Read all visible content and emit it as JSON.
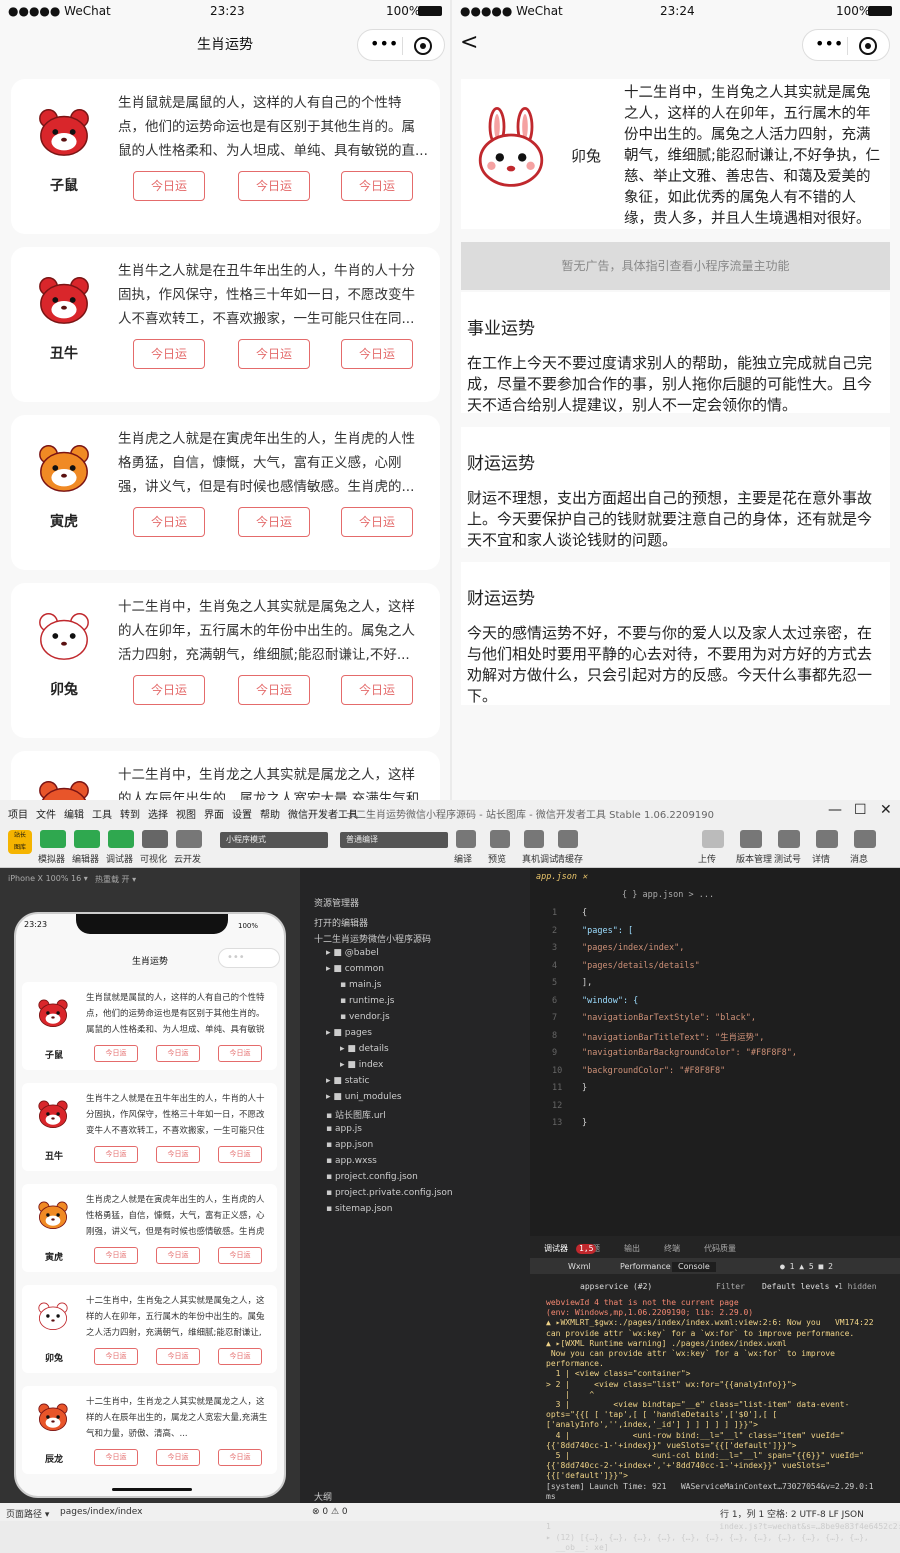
{
  "left_phone": {
    "status": {
      "carrier": "●●●●● WeChat",
      "time": "23:23",
      "battery": "100%"
    },
    "title": "生肖运势",
    "cards": [
      {
        "name": "子鼠",
        "desc": "生肖鼠就是属鼠的人，这样的人有自己的个性特点，他们的运势命运也是有区别于其他生肖的。属鼠的人性格柔和、为人坦成、单纯、具有敏锐的直...",
        "color": "#d9262b"
      },
      {
        "name": "丑牛",
        "desc": "生肖牛之人就是在丑牛年出生的人，牛肖的人十分固执，作风保守，性格三十年如一日，不愿改变牛人不喜欢转工，不喜欢搬家，一生可能只住在同...",
        "color": "#d9262b"
      },
      {
        "name": "寅虎",
        "desc": "生肖虎之人就是在寅虎年出生的人，生肖虎的人性格勇猛，自信，慷慨，大气，富有正义感，心刚强，讲义气，但是有时候也感情敏感。生肖虎的...",
        "color": "#f08a24"
      },
      {
        "name": "卯兔",
        "desc": "十二生肖中，生肖兔之人其实就是属兔之人，这样的人在卯年，五行属木的年份中出生的。属兔之人活力四射，充满朝气，维细腻;能忍耐谦让,不好...",
        "color": "#f6f0f0"
      },
      {
        "name": "辰龙",
        "desc": "十二生肖中，生肖龙之人其实就是属龙之人，这样的人在辰年出生的，属龙之人宽宏大量,充满生气和力量，骄傲、清高、...",
        "color": "#e8552a"
      }
    ],
    "button_label": "今日运"
  },
  "right_phone": {
    "status": {
      "carrier": "●●●●● WeChat",
      "time": "23:24",
      "battery": "100%"
    },
    "back": "<",
    "header": {
      "name": "卯兔",
      "desc": "十二生肖中，生肖兔之人其实就是属兔之人，这样的人在卯年，五行属木的年份中出生的。属兔之人活力四射，充满朝气，维细腻;能忍耐谦让,不好争执，仁慈、举止文雅、善忠告、和蔼及爱美的象征，如此优秀的属兔人有不错的人缘，贵人多，并且人生境遇相对很好。"
    },
    "ad": "暂无广告，具体指引查看小程序流量主功能",
    "sections": [
      {
        "title": "事业运势",
        "text": "在工作上今天不要过度请求别人的帮助，能独立完成就自己完成，尽量不要参加合作的事，别人拖你后腿的可能性大。且今天不适合给别人提建议，别人不一定会领你的情。"
      },
      {
        "title": "财运运势",
        "text": "财运不理想，支出方面超出自己的预想，主要是花在意外事故上。今天要保护自己的钱财就要注意自己的身体，还有就是今天不宜和家人谈论钱财的问题。"
      },
      {
        "title": "财运运势",
        "text": "今天的感情运势不好，不要与你的爱人以及家人太过亲密，在与他们相处时要用平静的心去对待，不要用为对方好的方式去劝解对方做什么，只会引起对方的反感。今天什么事都先忍一下。"
      }
    ]
  },
  "ide": {
    "menu": [
      "项目",
      "文件",
      "编辑",
      "工具",
      "转到",
      "选择",
      "视图",
      "界面",
      "设置",
      "帮助",
      "微信开发者工具"
    ],
    "window_title": "十二生肖运势微信小程序源码 - 站长图库 - 微信开发者工具 Stable 1.06.2209190",
    "toolbar_left": [
      "模拟器",
      "编辑器",
      "调试器",
      "可视化",
      "云开发"
    ],
    "mode": "小程序模式",
    "compile": "普通编译",
    "toolbar_mid": [
      "编译",
      "预览",
      "真机调试",
      "清缓存"
    ],
    "toolbar_right": [
      "上传",
      "版本管理",
      "测试号",
      "详情",
      "消息"
    ],
    "device": "iPhone X 100% 16 ▾",
    "hotreload": "热重载 开 ▾",
    "sim_time": "23:23",
    "sim_battery": "100%",
    "sim_title": "生肖运势",
    "explorer_title": "资源管理器",
    "open_editors": "打开的编辑器",
    "project": "十二生肖运势微信小程序源码",
    "files": [
      "@babel",
      "common",
      "main.js",
      "runtime.js",
      "vendor.js",
      "pages",
      "details",
      "index",
      "static",
      "uni_modules",
      "站长图库.url",
      "app.js",
      "app.json",
      "app.wxss",
      "project.config.json",
      "project.private.config.json",
      "sitemap.json"
    ],
    "outline": "大纲",
    "tab": "app.json",
    "crumb": "{ } app.json > ...",
    "code_lines": [
      "{",
      "  \"pages\": [",
      "    \"pages/index/index\",",
      "    \"pages/details/details\"",
      "  ],",
      "  \"window\": {",
      "    \"navigationBarTextStyle\": \"black\",",
      "    \"navigationBarTitleText\": \"生肖运势\",",
      "    \"navigationBarBackgroundColor\": \"#F8F8F8\",",
      "    \"backgroundColor\": \"#F8F8F8\"",
      "  }",
      "",
      "}"
    ],
    "console_tabs": [
      "调试器",
      "问题",
      "输出",
      "终端",
      "代码质量"
    ],
    "console_badge": "1,5",
    "devtools_tabs": [
      "Wxml",
      "Performance",
      "Console"
    ],
    "devtools_counts": "● 1 ▲ 5 ■ 2",
    "context": "appservice (#2)",
    "filter": "Filter",
    "levels": "Default levels ▾",
    "hidden": "1 hidden",
    "console_lines": [
      "webviewId 4 that is not the current page",
      "(env: Windows,mp,1.06.2209190; lib: 2.29.0)",
      "▲ ▸WXMLRT_$gwx:./pages/index/index.wxml:view:2:6: Now you   VM174:22",
      "can provide attr `wx:key` for a `wx:for` to improve performance.",
      "▲ ▸[WXML Runtime warning] ./pages/index/index.wxml",
      " Now you can provide attr `wx:key` for a `wx:for` to improve",
      "performance.",
      "  1 | <view class=\"container\">",
      "> 2 |     <view class=\"list\" wx:for=\"{{analyInfo}}\">",
      "    |    ^",
      "  3 |         <view bindtap=\"__e\" class=\"list-item\" data-event-",
      "opts=\"{{[ [ 'tap',[ [ 'handleDetails',['$0'],[ [",
      "['analyInfo','',index,'_id'] ] ] ] ] ] ]}}\">",
      "  4 |             <uni-row bind:__l=\"__l\" class=\"item\" vueId=\"",
      "{{'8dd740cc-1-'+index}}\" vueSlots=\"{{['default']}}\">",
      "  5 |                 <uni-col bind:__l=\"__l\" span=\"{{6}}\" vueId=\"",
      "{{'8dd740cc-2-'+index+','+'8dd740cc-1-'+index}}\" vueSlots=\"",
      "{{['default']}}\">",
      "[system] Launch Time: 921   WAServiceMainContext…73027054&v=2.29.0:1",
      "ms",
      "                                    index.js?t=wechat&s=…8be9e83f4e6452c2:41",
      "▸ (12) [{…}, {…}, {…}, {…}, {…}, {…}, {…}, {…}, {…}, {…}, {…}, {…}]",
      "1                                   index.js?t=wechat&s=…8be9e83f4e6452c2:41",
      "▸ (12) [{…}, {…}, {…}, {…}, {…}, {…}, {…}, {…}, {…}, {…}, {…}, {…},",
      "  __ob__: xe]"
    ],
    "status_left": "页面路径 ▾",
    "status_path": "pages/index/index",
    "status_issues": "⊗ 0 ⚠ 0",
    "status_right": [
      "行 1，列 1",
      "空格: 2",
      "UTF-8",
      "LF",
      "JSON"
    ]
  }
}
